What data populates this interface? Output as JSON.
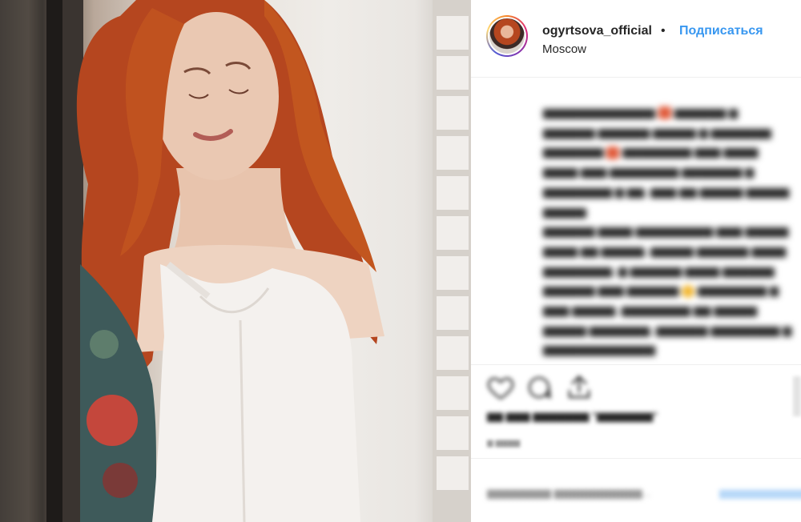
{
  "post": {
    "photo_alt": "woman with curly red hair in white dress by a window"
  },
  "header": {
    "username": "ogyrtsova_official",
    "separator": "•",
    "follow_label": "Подписаться",
    "location": "Moscow"
  },
  "icons": {
    "like": "heart-icon",
    "comment": "comment-icon",
    "share": "share-icon"
  },
  "colors": {
    "accent": "#3897f0",
    "text": "#262626",
    "hair": "#b5461f"
  }
}
